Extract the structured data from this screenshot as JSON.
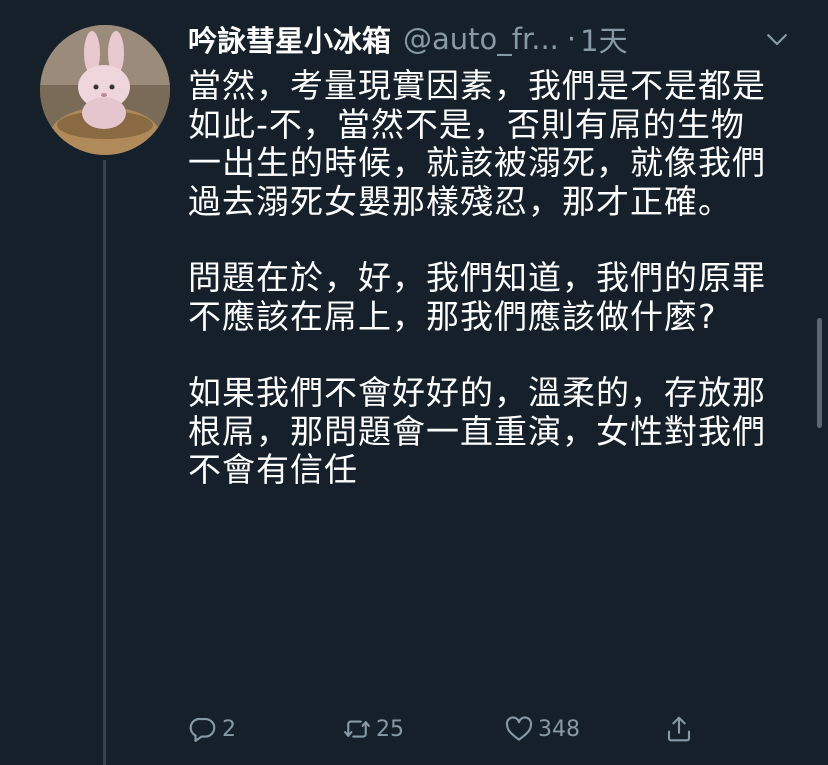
{
  "tweet": {
    "display_name": "吟詠彗星小冰箱",
    "handle": "@auto_fr...",
    "separator": "·",
    "time": "1天",
    "paragraphs": [
      "當然，考量現實因素，我們是不是都是如此-不，當然不是，否則有屌的生物一出生的時候，就該被溺死，就像我們過去溺死女嬰那樣殘忍，那才正確。",
      "問題在於，好，我們知道，我們的原罪不應該在屌上，那我們應該做什麼?",
      "如果我們不會好好的，溫柔的，存放那根屌，那問題會一直重演，女性對我們不會有信任"
    ],
    "actions": {
      "reply_count": "2",
      "retweet_count": "25",
      "like_count": "348"
    }
  },
  "colors": {
    "background": "#15202b",
    "primary_text": "#ffffff",
    "secondary_text": "#8899a6",
    "thread_line": "#38444d"
  },
  "icons": [
    "caret-down-icon",
    "reply-icon",
    "retweet-icon",
    "like-icon",
    "share-icon"
  ]
}
